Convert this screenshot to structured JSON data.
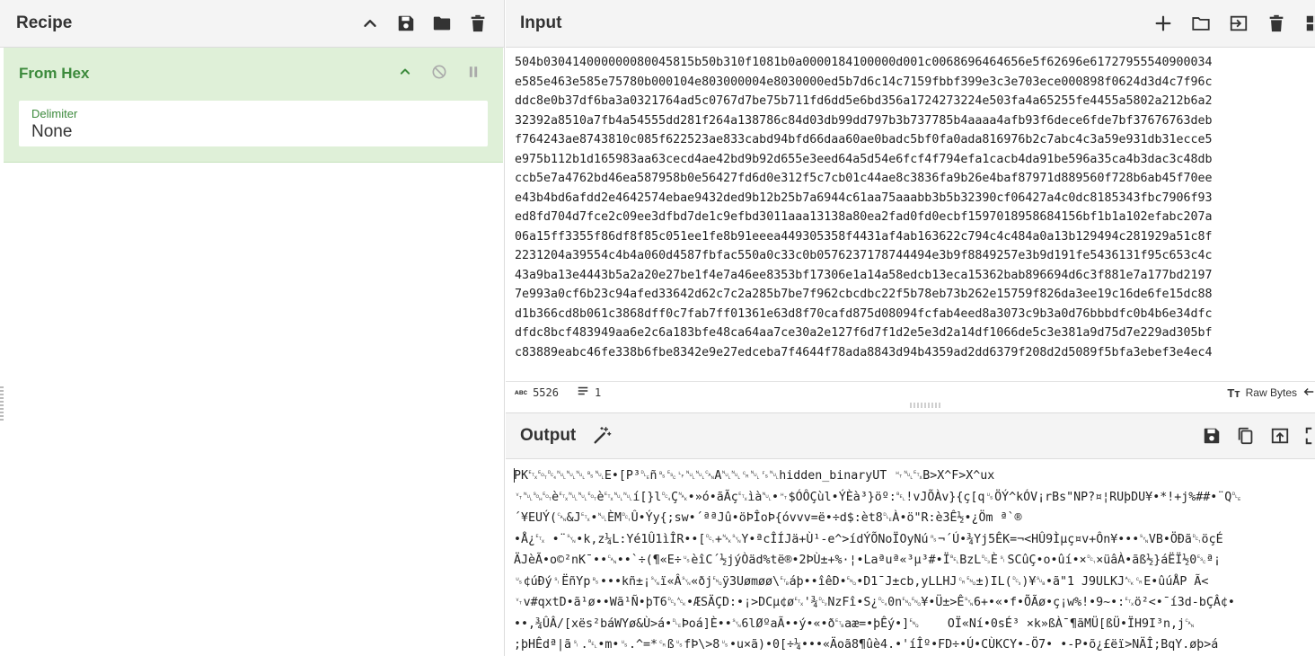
{
  "recipe": {
    "title": "Recipe",
    "operation": {
      "name": "From Hex",
      "field_label": "Delimiter",
      "field_value": "None"
    }
  },
  "input": {
    "title": "Input",
    "lines": [
      "504b03041400000008004581​5b50b310f1081b0a0000184100000d001c0068696464656e5f62696e61727955540900034",
      "e585e463e585e75780b000104e803000004e8030000ed5b7d6c14c7159fbbf399e3c3e703ece000898f0624d3d4c7f96c",
      "ddc8e0b37df6ba3a0321764ad5c0767d7be75b711fd6dd5e6bd356a1724273224e503fa4a65255fe4455a5802a212b6a2",
      "32392a8510a7fb4a54555dd281f264a138786c84d03db99dd797b3b737785b4aaaa4afb93f6dece6fde7bf37676763deb",
      "f764243ae8743810c085f622523ae833cabd94bfd66daa60ae0badc5bf0fa0ada816976b2c7abc4c3a59e931db31ecce5",
      "e975b112b1d165983aa63cecd4ae42bd9b92d655e3eed64a5d54e6fcf4f794efa1cacb4da91be596a35ca4b3dac3c48db",
      "ccb5e7a4762bd46ea587958b0e56427fd6d0e312f5c7cb01c44ae8c3836fa9b26e4baf87971d889560f728b6ab45f70ee",
      "e43b4bd6afdd2e4642574ebae9432ded9b12b25b7a6944c61aa75aaabb3b5b32390cf06427a4c0dc8185343fbc7906f93",
      "ed8fd704d7fce2c09ee3dfbd7de1c9efbd3011aaa13138a80ea2fad0fd0ecbf1597018958684156bf1b1a102efabc207a",
      "06a15ff3355f86df8f85c051ee1fe8b91eeea449305358f4431af4ab163622c794c4c484a0a13b129494c281929a51c8f",
      "2231204a39554c4b4a060d4587fbfac550a0c33c0b0576237178744494e3b9f8849257e3b9d191fe5436131f95c653c4c",
      "43a9ba13e4443b5a2a20e27be1f4e7a46ee8353bf17306e1a14a58edcb13eca15362bab896694d6c3f881e7a177bd2197",
      "7e993a0cf6b23c94afed33642d62c7c2a285b7be7f962cbcdbc22f5b78eb73b262e15759f826da3ee19c16de6fe15dc88",
      "d1b366cd8b061c3868dff0c7fab7ff01361e63d8f70cafd875d08094fcfab4eed8a3073c9b3a0d76bbbdfc0b4b6e34dfc",
      "dfdc8bcf483949aa6e2c6a183bfe48ca64aa7ce30a2e127f6d7f1d2e5e3d2a14df1066de5c3e381a9d75d7e229ad305bf",
      "c83889eabc46fe338b6fbe8342e9e27edceba7f4644f78ada8843d94b4359ad2dd6379f208d2d5089f5bfa3ebef3e4ec4"
    ],
    "status": {
      "length": "5526",
      "lines": "1",
      "encoding": "Raw Bytes"
    }
  },
  "output": {
    "title": "Output",
    "lines": [
      "PK␃␄␔␀␀␀␈␀E•[P³␐ñ␈␛␊␀␀␘A␀␀␍␀␜␀hidden_binaryUT ␉␀␃B>X^F>X^ux",
      "␋␀␁␄è␃␀␀␄è␃␀␀í[}l␔Ç␕•»ó•ãÃç␃ìà␀•␉$ÓÔÇùl•ÝÈà³}öº:␇!vJÕÀv}{ç[q␟ÖÝ^kÓV¡rBs\"NP?¤¦RUþDU¥•*!+j%##•¨Q␐",
      "´¥EUÝ(␘&J␃•␀ÈM␑Û•Ýy{;sw•´ªªJû•öÞÎoÞ{óvvv=ë•÷d$:èt8␐À•ö\"R:è3Ê½•¿Öm ª`®",
      "•Å¿␃ •¨␖•k,z¼L:Yé1Û1ìÎR••[␑+␕␖Y•ªcÎÍJä+Ù¹-e^>ídÝÕNoÏOyNú␞¬´Ú•¾Yj5ÊK=¬<HÛ9Ìµç¤v+Ôn¥•••␖VB•ÖÐã␑öçÉ",
      "ÄJèÃ•o©²nK¯••␘••`÷(¶«E÷␟èîC´½jýÒäd%të®•2ÞÙ±+%·¦•Laªuª«³µ³#•Ï␇BzL␓È␏SCûÇ•o•ûí•×␑×üâÀ•ãß½}áËÏ½0␛ª¡",
      "␟¢úÐý␏ËñYp␈•••kñ±¡␖ï«Â␖«ðj␅ÿ3Uømøø\\␗áþ••îêD•␅•D1¯J±cb,yLLHJ␍␅±)IL(␓)¥␚•ã\"1 J9ULKJ␆␍E•ûúÅP Ã<",
      "␋v#qxtD•ã¹ø••Wã¹Ñ•þT6␓␆•ÆSÄÇD:•¡>DCµ¢ø␃'¾␒NzFî•S¿␔0n␅␅¥•Ü±>Ê␖6+•«•f•ÕÃø•ç¡w%!•9~•:␃ö²<•¯í3d-bÇÂ¢•",
      "••,¾ÛÂ/[xës²báWYø&Ù>á•␐Þoá]È••␖6lØºaÃ••ý•«•ð␗aæ=•þÊý•]␅    OÏ«Ní•0sÉ³ ×k»ßÀ¯¶ãMÜ[ßÜ•ÏH9I³n,j␘",
      ";þHÊdª|ã␏.␇•m•␟.^=*␍ß␟fÞ\\>8␟•u×ã)•0[÷¼•••«Äoã8¶ûè4.•'íÎº•FD÷•Ú•CÙKCY•-Ö7• •-P•õ¿£ëï>NÄÎ;BqY.øþ>á"
    ]
  }
}
